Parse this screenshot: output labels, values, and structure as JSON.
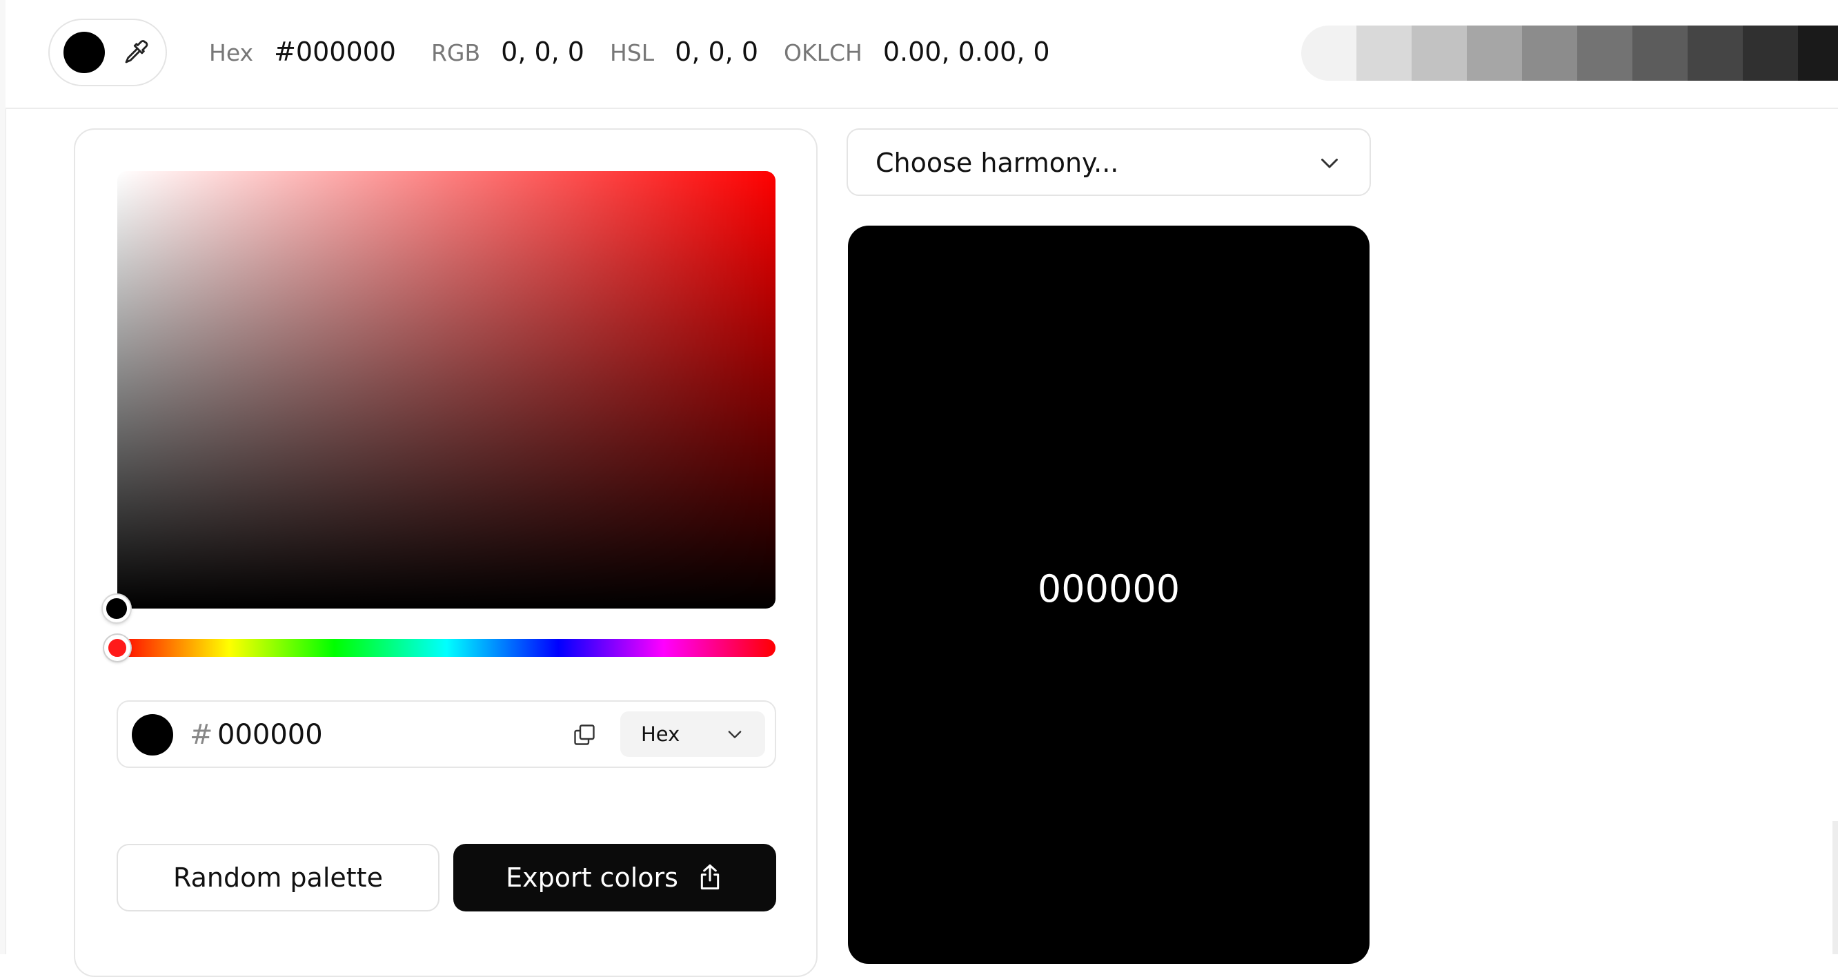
{
  "current_color": "#000000",
  "topbar": {
    "readouts": [
      {
        "key": "Hex",
        "value": "#000000"
      },
      {
        "key": "RGB",
        "value": "0, 0, 0"
      },
      {
        "key": "HSL",
        "value": "0, 0, 0"
      },
      {
        "key": "OKLCH",
        "value": "0.00, 0.00, 0"
      }
    ],
    "shades": [
      "#f2f2f2",
      "#d9d9d9",
      "#c2c2c2",
      "#a6a6a6",
      "#8c8c8c",
      "#737373",
      "#5c5c5c",
      "#454545",
      "#303030",
      "#1a1a1a"
    ],
    "picker_icon": "eyedropper-icon"
  },
  "picker": {
    "hue_color": "#ff0000",
    "hex_input": {
      "prefix": "#",
      "value": "000000"
    },
    "copy_icon": "copy-icon",
    "format": {
      "label": "Hex",
      "icon": "chevron-down-icon"
    }
  },
  "actions": {
    "random_label": "Random palette",
    "export_label": "Export colors",
    "export_icon": "share-icon"
  },
  "harmony": {
    "placeholder": "Choose harmony...",
    "icon": "chevron-down-icon"
  },
  "preview": {
    "code": "000000"
  }
}
